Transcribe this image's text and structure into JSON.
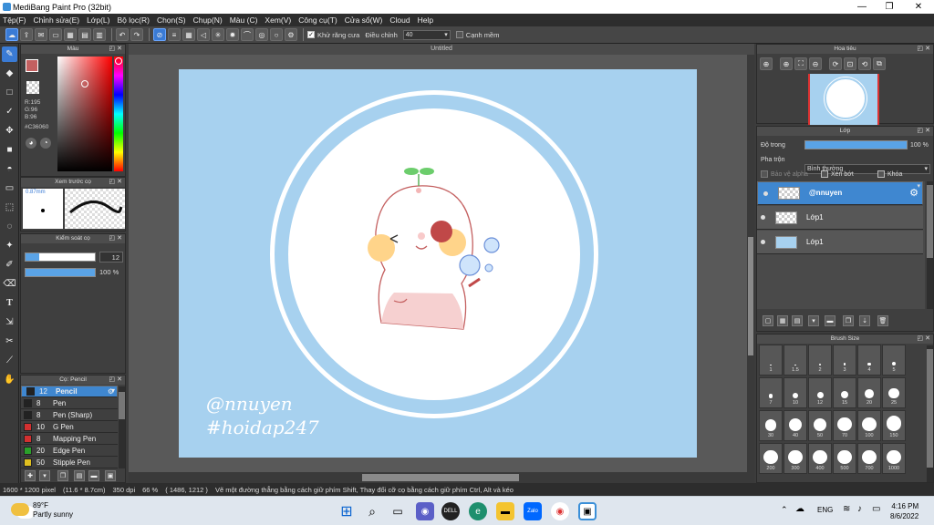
{
  "window": {
    "title": "MediBang Paint Pro (32bit)",
    "minimize": "—",
    "maximize": "❐",
    "close": "✕"
  },
  "menu": [
    "Tệp(F)",
    "Chỉnh sửa(E)",
    "Lớp(L)",
    "Bộ lọc(R)",
    "Chọn(S)",
    "Chụp(N)",
    "Màu (C)",
    "Xem(V)",
    "Công cụ(T)",
    "Cửa sổ(W)",
    "Cloud",
    "Help"
  ],
  "toolbar": {
    "antialias_label": "Khử răng cưa",
    "adjust_label": "Điều chỉnh",
    "adjust_value": "40",
    "edge_label": "Cạnh mềm"
  },
  "canvas": {
    "tab_title": "Untitled",
    "watermark_line1": "@nnuyen",
    "watermark_line2": "#hoidap247"
  },
  "color_panel": {
    "title": "Màu",
    "r": "R:195",
    "g": "G:96",
    "b": "B:96",
    "hex": "#C36060",
    "primary_color": "#c36060"
  },
  "preview_panel": {
    "title": "Xem trước cọ",
    "size": "0.87mm"
  },
  "brush_control": {
    "title": "Kiểm soát cọ",
    "size_value": "12",
    "opacity_value": "100 %"
  },
  "brush_list": {
    "title": "Cọ: Pencil",
    "items": [
      {
        "size": "12",
        "name": "Pencil",
        "color": "#222222"
      },
      {
        "size": "8",
        "name": "Pen",
        "color": "#222222"
      },
      {
        "size": "8",
        "name": "Pen (Sharp)",
        "color": "#222222"
      },
      {
        "size": "10",
        "name": "G Pen",
        "color": "#d33030"
      },
      {
        "size": "8",
        "name": "Mapping Pen",
        "color": "#d33030"
      },
      {
        "size": "20",
        "name": "Edge Pen",
        "color": "#2aa02a"
      },
      {
        "size": "50",
        "name": "Stipple Pen",
        "color": "#e0c020"
      }
    ]
  },
  "navigator": {
    "title": "Hoa tiêu"
  },
  "layers": {
    "title": "Lớp",
    "opacity_label": "Độ trong",
    "opacity_value": "100 %",
    "blend_label": "Pha trộn",
    "blend_value": "Bình thường",
    "protect_alpha": "Bảo vệ alpha",
    "clipping": "Xén bớt",
    "lock": "Khóa",
    "items": [
      "@nnuyen",
      "Lớp1",
      "Lớp1"
    ]
  },
  "brush_size": {
    "title": "Brush Size",
    "sizes": [
      "1",
      "1.5",
      "2",
      "3",
      "4",
      "5",
      "7",
      "10",
      "12",
      "15",
      "20",
      "25",
      "30",
      "40",
      "50",
      "70",
      "100",
      "150",
      "200",
      "300",
      "400",
      "500",
      "700",
      "1000"
    ]
  },
  "status": {
    "dims": "1600 * 1200 pixel",
    "physical": "(11.6 * 8.7cm)",
    "dpi": "350 dpi",
    "zoom": "66 %",
    "cursor": "( 1486, 1212 )",
    "hint": "Vẽ một đường thẳng bằng cách giữ phím Shift, Thay đổi cỡ cọ bằng cách giữ phím Ctrl, Alt và kéo"
  },
  "taskbar": {
    "temp": "89°F",
    "weather": "Partly sunny",
    "lang": "ENG",
    "time": "4:16 PM",
    "date": "8/6/2022"
  }
}
